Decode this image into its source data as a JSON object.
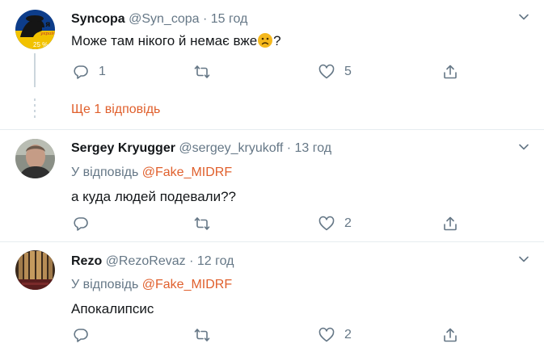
{
  "tweets": [
    {
      "name": "Syncopa",
      "handle": "@Syn_copa",
      "separator": "·",
      "time": "15 год",
      "text": "Може там нікого й немає вже",
      "text_suffix": "?",
      "emoji": "frowning-face-emoji",
      "avatar_overlay": "25 %",
      "actions": {
        "replies": "1",
        "retweets": "",
        "likes": "5"
      },
      "show_more": "Ще 1 відповідь"
    },
    {
      "name": "Sergey Kryugger",
      "handle": "@sergey_kryukoff",
      "separator": "·",
      "time": "13 год",
      "reply_prefix": "У відповідь",
      "reply_mention": "@Fake_MIDRF",
      "text": "а куда людей подевали??",
      "actions": {
        "replies": "",
        "retweets": "",
        "likes": "2"
      }
    },
    {
      "name": "Rezo",
      "handle": "@RezoRevaz",
      "separator": "·",
      "time": "12 год",
      "reply_prefix": "У відповідь",
      "reply_mention": "@Fake_MIDRF",
      "text": "Апокалипсис",
      "actions": {
        "replies": "",
        "retweets": "",
        "likes": "2"
      }
    }
  ],
  "icons": {
    "reply": "reply-icon",
    "retweet": "retweet-icon",
    "like": "heart-icon",
    "share": "share-icon",
    "caret": "chevron-down-icon"
  },
  "colors": {
    "link": "#e0602d",
    "secondary": "#657786",
    "text": "#14171a",
    "border": "#e6ecf0"
  }
}
